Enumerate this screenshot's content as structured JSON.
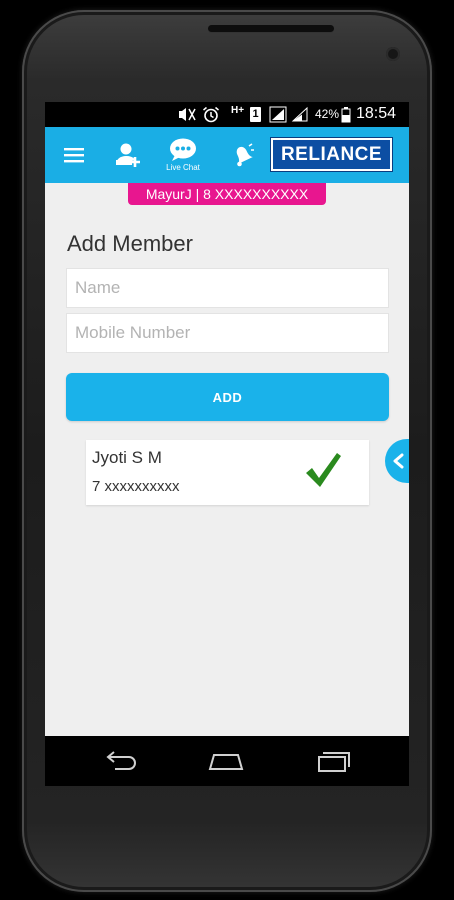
{
  "status_bar": {
    "battery_percent": "42%",
    "time": "18:54",
    "network_label": "H+",
    "sim_slot": "1"
  },
  "toolbar": {
    "live_chat_label": "Live Chat",
    "brand": "RELIANCE"
  },
  "user_banner": "MayurJ | 8 XXXXXXXXXX",
  "page_title": "Add Member",
  "form": {
    "name_placeholder": "Name",
    "mobile_placeholder": "Mobile Number",
    "add_label": "ADD"
  },
  "members": [
    {
      "name": "Jyoti S M",
      "phone": "7 xxxxxxxxxx",
      "status": "check-icon"
    }
  ],
  "colors": {
    "toolbar": "#1aaee5",
    "banner": "#e8168f",
    "button": "#1ab2ea",
    "check": "#2a8a1e",
    "brand_bg": "#0c4ea3"
  }
}
